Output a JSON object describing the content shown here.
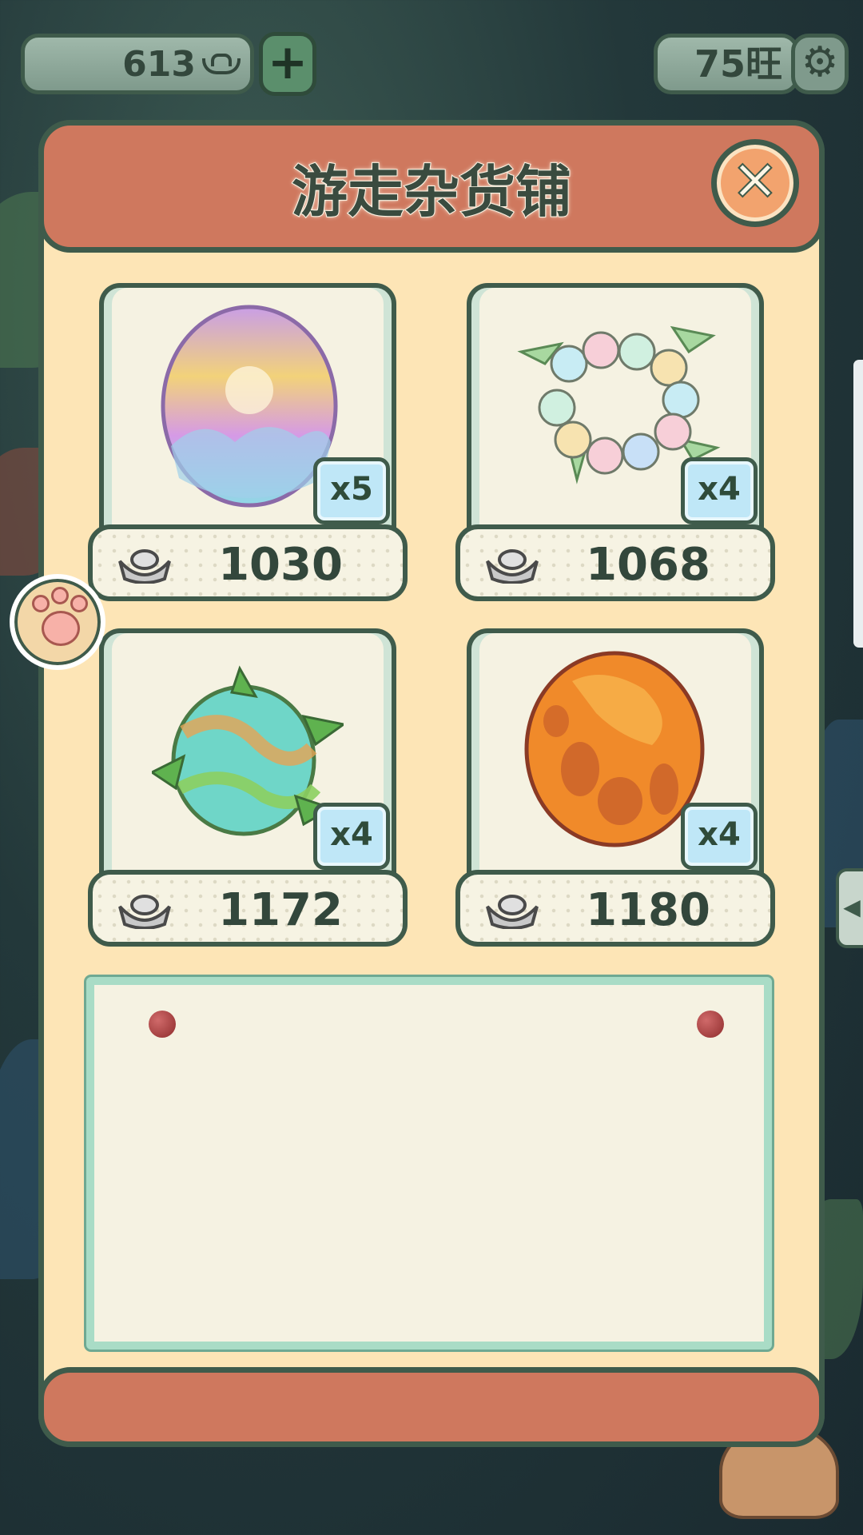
{
  "topbar": {
    "currency_amount": "613",
    "add_label": "+",
    "wang_label": "75旺",
    "settings_icon": "gear-icon"
  },
  "shop": {
    "title": "游走杂货铺",
    "close_label": "✕",
    "items": [
      {
        "name": "rainbow-egg",
        "icon": "rainbow-egg-icon",
        "quantity": "x5",
        "price": "1030"
      },
      {
        "name": "flower-wreath",
        "icon": "flower-wreath-icon",
        "quantity": "x4",
        "price": "1068"
      },
      {
        "name": "leaf-egg",
        "icon": "leaf-egg-icon",
        "quantity": "x4",
        "price": "1172"
      },
      {
        "name": "lava-egg",
        "icon": "lava-egg-icon",
        "quantity": "x4",
        "price": "1180"
      }
    ]
  },
  "colors": {
    "panel_bg": "#fde5b6",
    "header_bg": "#cf785e",
    "border": "#3f5b4b",
    "badge_bg": "#bfe7f7",
    "note_border": "#a9dcc6"
  }
}
